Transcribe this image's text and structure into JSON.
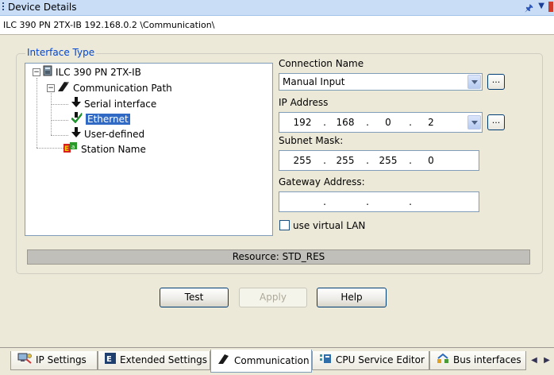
{
  "window": {
    "title": "Device Details",
    "path": "ILC 390 PN 2TX-IB 192.168.0.2 \\Communication\\"
  },
  "interface_type": {
    "legend": "Interface Type",
    "tree": {
      "root": "ILC 390 PN 2TX-IB",
      "communication_path": "Communication Path",
      "serial": "Serial interface",
      "ethernet": "Ethernet",
      "user_defined": "User-defined",
      "station_name": "Station Name"
    }
  },
  "connection": {
    "name_label": "Connection Name",
    "name_value": "Manual Input",
    "ip_label": "IP Address",
    "ip": [
      "192",
      "168",
      "0",
      "2"
    ],
    "subnet_label": "Subnet Mask:",
    "subnet": [
      "255",
      "255",
      "255",
      "0"
    ],
    "gateway_label": "Gateway Address:",
    "gateway": [
      "",
      "",
      "",
      ""
    ],
    "ellipsis": "...",
    "dot": ".",
    "vlan_label": "use virtual LAN",
    "vlan_checked": false
  },
  "resource": "Resource: STD_RES",
  "buttons": {
    "test": "Test",
    "apply": "Apply",
    "help": "Help"
  },
  "tabs": [
    {
      "label": "IP Settings",
      "icon": "network-computer-icon"
    },
    {
      "label": "Extended Settings",
      "icon": "settings-document-icon"
    },
    {
      "label": "Communication",
      "icon": "communication-icon",
      "active": true
    },
    {
      "label": "CPU Service Editor",
      "icon": "cpu-service-icon"
    },
    {
      "label": "Bus interfaces",
      "icon": "bus-interface-icon"
    }
  ],
  "colors": {
    "selection": "#316ac5",
    "legend": "#0046d5",
    "titlebar": "#c9ddf6"
  }
}
